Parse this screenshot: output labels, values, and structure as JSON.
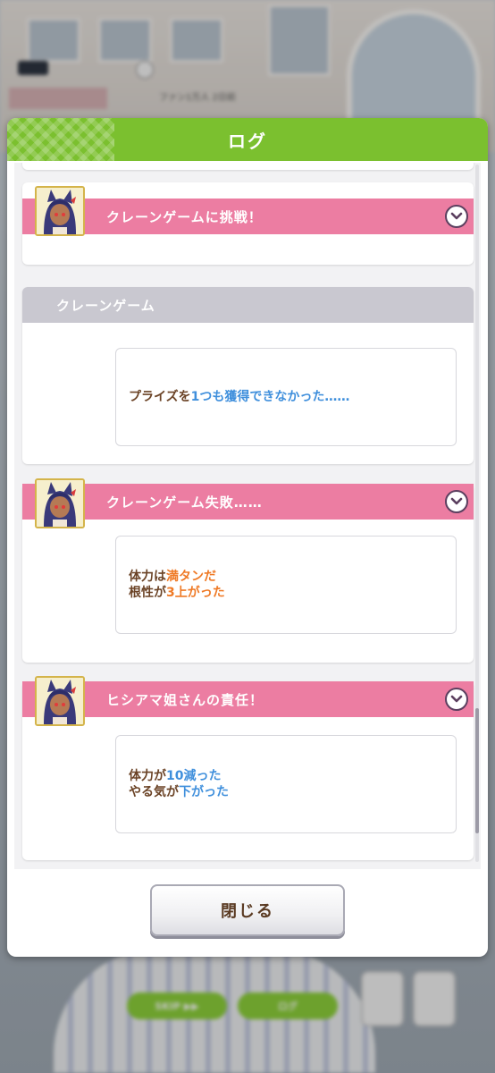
{
  "background": {
    "chip_text": "",
    "label_text": "ファン1万人 2日前",
    "skip_button": "SKIP ▶▶",
    "log_button": "ログ"
  },
  "dialog": {
    "title": "ログ",
    "close_label": "閉じる"
  },
  "entries": [
    {
      "type": "event",
      "title": "クレーンゲームに挑戦！",
      "collapsed": true
    },
    {
      "type": "section",
      "title": "クレーンゲーム",
      "message": [
        [
          {
            "t": "プライズを",
            "c": "brown"
          },
          {
            "t": "1つも獲得できなかった……",
            "c": "blue"
          }
        ]
      ]
    },
    {
      "type": "event",
      "title": "クレーンゲーム失敗……",
      "message": [
        [
          {
            "t": "体力は",
            "c": "brown"
          },
          {
            "t": "満タン",
            "c": "orange"
          },
          {
            "t": "だ",
            "c": "brown"
          }
        ],
        [
          {
            "t": "根性が",
            "c": "brown"
          },
          {
            "t": "3上がった",
            "c": "orange"
          }
        ]
      ]
    },
    {
      "type": "event",
      "title": "ヒシアマ姐さんの責任！",
      "message": [
        [
          {
            "t": "体力が",
            "c": "brown"
          },
          {
            "t": "10減った",
            "c": "blue"
          }
        ],
        [
          {
            "t": "やる気が",
            "c": "brown"
          },
          {
            "t": "下がった",
            "c": "blue"
          }
        ]
      ]
    }
  ],
  "colors": {
    "header_green": "#7bc02f",
    "event_pink": "#ec7da2",
    "section_gray": "#c9c8d0",
    "text_brown": "#6b4326",
    "value_blue": "#3f8fdc",
    "value_orange": "#ef7a26"
  },
  "icons": [
    "chevron-down-icon",
    "character-avatar"
  ],
  "scroll_fraction": 0.95
}
